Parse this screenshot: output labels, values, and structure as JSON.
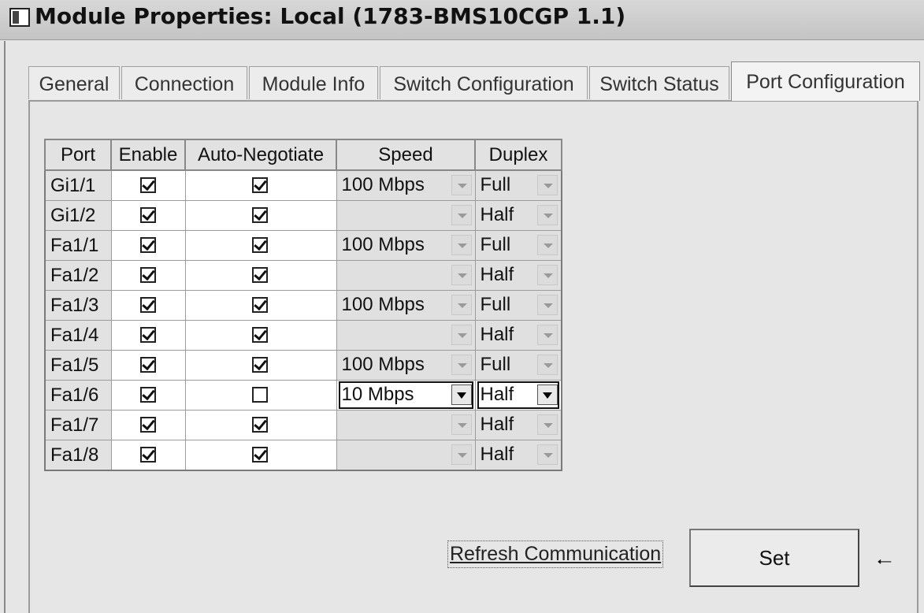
{
  "window": {
    "title": "Module Properties: Local (1783-BMS10CGP 1.1)"
  },
  "tabs": [
    {
      "label": "General"
    },
    {
      "label": "Connection"
    },
    {
      "label": "Module Info"
    },
    {
      "label": "Switch Configuration"
    },
    {
      "label": "Switch Status"
    },
    {
      "label": "Port Configuration",
      "active": true
    }
  ],
  "table": {
    "headers": {
      "port": "Port",
      "enable": "Enable",
      "auto": "Auto-Negotiate",
      "speed": "Speed",
      "duplex": "Duplex"
    },
    "rows": [
      {
        "port": "Gi1/1",
        "enable": true,
        "auto": true,
        "speed": "100 Mbps",
        "duplex": "Full"
      },
      {
        "port": "Gi1/2",
        "enable": true,
        "auto": true,
        "speed": "",
        "duplex": "Half"
      },
      {
        "port": "Fa1/1",
        "enable": true,
        "auto": true,
        "speed": "100 Mbps",
        "duplex": "Full"
      },
      {
        "port": "Fa1/2",
        "enable": true,
        "auto": true,
        "speed": "",
        "duplex": "Half"
      },
      {
        "port": "Fa1/3",
        "enable": true,
        "auto": true,
        "speed": "100 Mbps",
        "duplex": "Full"
      },
      {
        "port": "Fa1/4",
        "enable": true,
        "auto": true,
        "speed": "",
        "duplex": "Half"
      },
      {
        "port": "Fa1/5",
        "enable": true,
        "auto": true,
        "speed": "100 Mbps",
        "duplex": "Full"
      },
      {
        "port": "Fa1/6",
        "enable": true,
        "auto": false,
        "speed": "10 Mbps",
        "duplex": "Half"
      },
      {
        "port": "Fa1/7",
        "enable": true,
        "auto": true,
        "speed": "",
        "duplex": "Half"
      },
      {
        "port": "Fa1/8",
        "enable": true,
        "auto": true,
        "speed": "",
        "duplex": "Half"
      }
    ]
  },
  "actions": {
    "refresh_label": "Refresh Communication",
    "set_label": "Set"
  },
  "icons": {
    "arrow": "arrow-left-icon",
    "window": "window-icon"
  }
}
